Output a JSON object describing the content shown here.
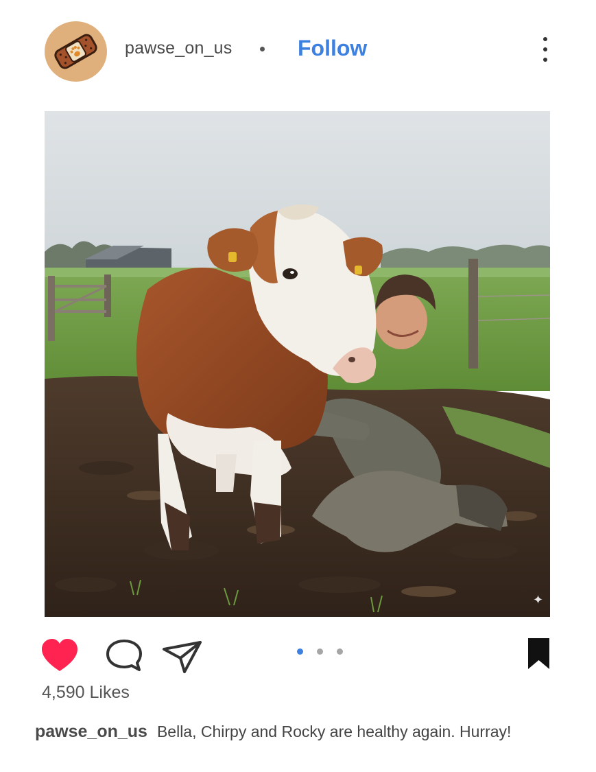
{
  "post": {
    "username": "pawse_on_us",
    "separator": "•",
    "follow_label": "Follow",
    "avatar_icon": "bandage-paw-icon",
    "image_alt": "Farmer kneeling in a muddy field beside a brown and white cow",
    "likes_text": "4,590 Likes",
    "caption_user": "pawse_on_us",
    "caption_text": "Bella, Chirpy and Rocky are healthy again. Hurray!"
  },
  "actions": {
    "like_icon": "heart-icon",
    "comment_icon": "comment-icon",
    "share_icon": "paper-plane-icon",
    "save_icon": "bookmark-icon",
    "liked": true
  },
  "carousel": {
    "count": 3,
    "active_index": 0
  },
  "colors": {
    "accent": "#3d80e0",
    "like": "#fe2350",
    "avatar_bg": "#dfb07c"
  }
}
